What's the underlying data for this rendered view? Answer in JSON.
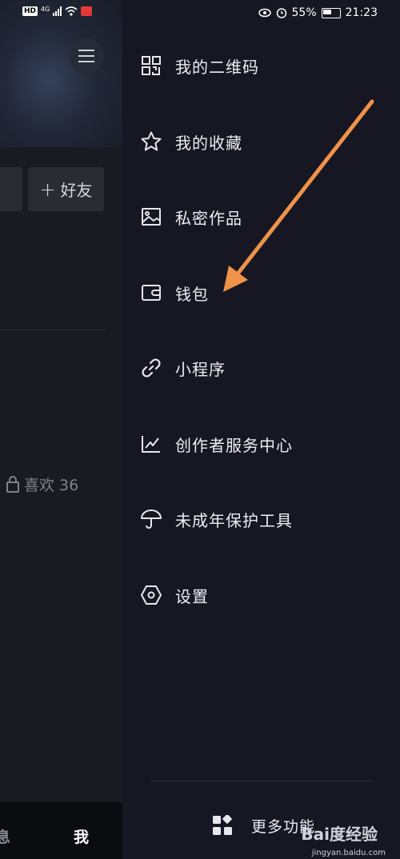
{
  "status_bar": {
    "left_badge": "HD",
    "network": "4G",
    "battery": "55%",
    "time": "21:23"
  },
  "profile": {
    "add_friend_label": "好友",
    "add_friend_icon": "plus-icon",
    "likes_label": "喜欢 36"
  },
  "bottom_nav": {
    "messages_label": "息",
    "me_label": "我"
  },
  "drawer": {
    "items": [
      {
        "label": "我的二维码",
        "icon": "qr-code-icon"
      },
      {
        "label": "我的收藏",
        "icon": "star-icon"
      },
      {
        "label": "私密作品",
        "icon": "image-icon"
      },
      {
        "label": "钱包",
        "icon": "wallet-icon"
      },
      {
        "label": "小程序",
        "icon": "link-icon"
      },
      {
        "label": "创作者服务中心",
        "icon": "chart-icon"
      },
      {
        "label": "未成年保护工具",
        "icon": "umbrella-icon"
      },
      {
        "label": "设置",
        "icon": "hexagon-icon"
      }
    ],
    "more_label": "更多功能",
    "more_icon": "grid-icon"
  },
  "annotation": {
    "arrow_color": "#f0924a"
  },
  "watermark": {
    "brand": "Bai度经验",
    "url": "jingyan.baidu.com"
  }
}
